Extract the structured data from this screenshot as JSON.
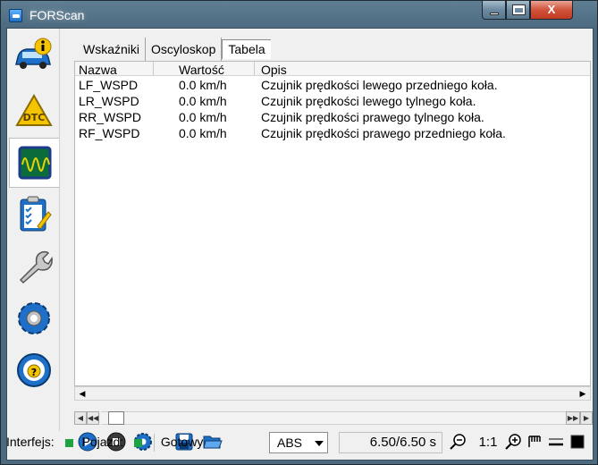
{
  "window": {
    "title": "FORScan",
    "close_glyph": "X"
  },
  "sidebar": {
    "items": [
      {
        "name": "info",
        "icon": "car-info-icon"
      },
      {
        "name": "dtc",
        "icon": "dtc-warning-icon",
        "label": "DTC"
      },
      {
        "name": "oscilloscope",
        "icon": "oscilloscope-icon"
      },
      {
        "name": "tests",
        "icon": "checklist-icon"
      },
      {
        "name": "service",
        "icon": "wrench-icon"
      },
      {
        "name": "configuration",
        "icon": "gear-icon"
      },
      {
        "name": "help",
        "icon": "help-wheel-icon"
      }
    ],
    "active_index": 2
  },
  "tabs": [
    {
      "label": "Wskaźniki"
    },
    {
      "label": "Oscyloskop"
    },
    {
      "label": "Tabela"
    }
  ],
  "active_tab": 2,
  "table": {
    "columns": [
      "Nazwa",
      "Wartość",
      "Opis"
    ],
    "rows": [
      {
        "name": "LF_WSPD",
        "value": "0.0 km/h",
        "desc": "Czujnik prędkości lewego przedniego koła."
      },
      {
        "name": "LR_WSPD",
        "value": "0.0 km/h",
        "desc": "Czujnik prędkości lewego tylnego koła."
      },
      {
        "name": "RR_WSPD",
        "value": "0.0 km/h",
        "desc": "Czujnik prędkości prawego tylnego koła."
      },
      {
        "name": "RF_WSPD",
        "value": "0.0 km/h",
        "desc": "Czujnik prędkości prawego przedniego koła."
      }
    ]
  },
  "toolbar": {
    "mode_select": "ABS",
    "time": "6.50/6.50 s",
    "zoom_ratio": "1:1"
  },
  "statusbar": {
    "interface_label": "Interfejs:",
    "vehicle_label": "Pojazd:",
    "status_text": "Gotowy",
    "led_color": "#1ea342"
  },
  "colors": {
    "accent_blue": "#1e6fc8",
    "title_bar": "#4c6a80"
  }
}
